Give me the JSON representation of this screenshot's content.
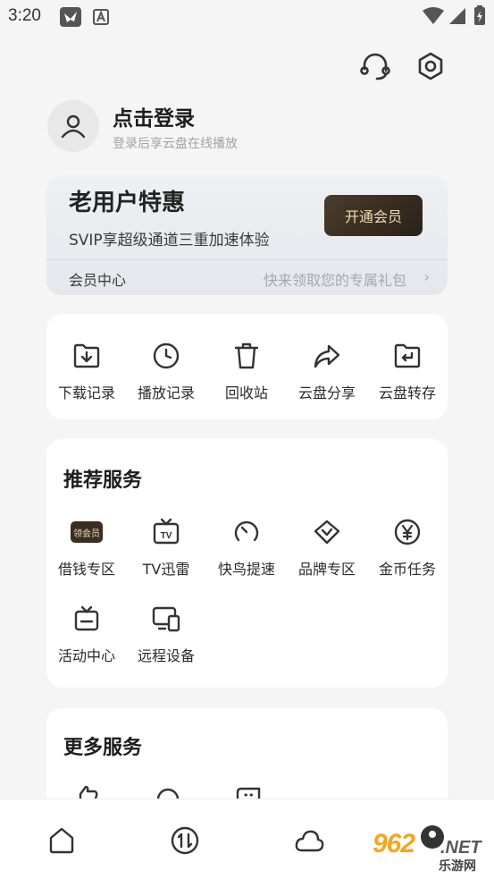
{
  "status_bar": {
    "time": "3:20"
  },
  "profile": {
    "login_title": "点击登录",
    "login_subtitle": "登录后享云盘在线播放"
  },
  "vip": {
    "title": "老用户特惠",
    "description": "SVIP享超级通道三重加速体验",
    "button_label": "开通会员",
    "center_label": "会员中心",
    "promo_text": "快来领取您的专属礼包",
    "chevron": "›"
  },
  "quick_actions": [
    {
      "label": "下载记录",
      "icon": "download-folder-icon"
    },
    {
      "label": "播放记录",
      "icon": "clock-icon"
    },
    {
      "label": "回收站",
      "icon": "trash-icon"
    },
    {
      "label": "云盘分享",
      "icon": "share-icon"
    },
    {
      "label": "云盘转存",
      "icon": "transfer-folder-icon"
    }
  ],
  "recommended": {
    "title": "推荐服务",
    "badge_text": "领会员",
    "items": [
      {
        "label": "借钱专区",
        "icon": "vip-badge-icon"
      },
      {
        "label": "TV迅雷",
        "icon": "tv-icon"
      },
      {
        "label": "快鸟提速",
        "icon": "speedometer-icon"
      },
      {
        "label": "品牌专区",
        "icon": "handshake-icon"
      },
      {
        "label": "金币任务",
        "icon": "yen-coin-icon"
      },
      {
        "label": "活动中心",
        "icon": "activity-tv-icon"
      },
      {
        "label": "远程设备",
        "icon": "remote-device-icon"
      }
    ]
  },
  "more_services": {
    "title": "更多服务"
  },
  "bottom_nav": [
    {
      "icon": "home-icon"
    },
    {
      "icon": "transfer-icon"
    },
    {
      "icon": "cloud-icon"
    },
    {
      "icon": "profile-icon"
    }
  ],
  "watermark": {
    "number": "962",
    "suffix": ".NET",
    "text": "乐游网"
  },
  "colors": {
    "background": "#f5f5f5",
    "vip_button": "#3a2e22",
    "vip_button_text": "#f3dcb4",
    "card": "#ffffff"
  }
}
